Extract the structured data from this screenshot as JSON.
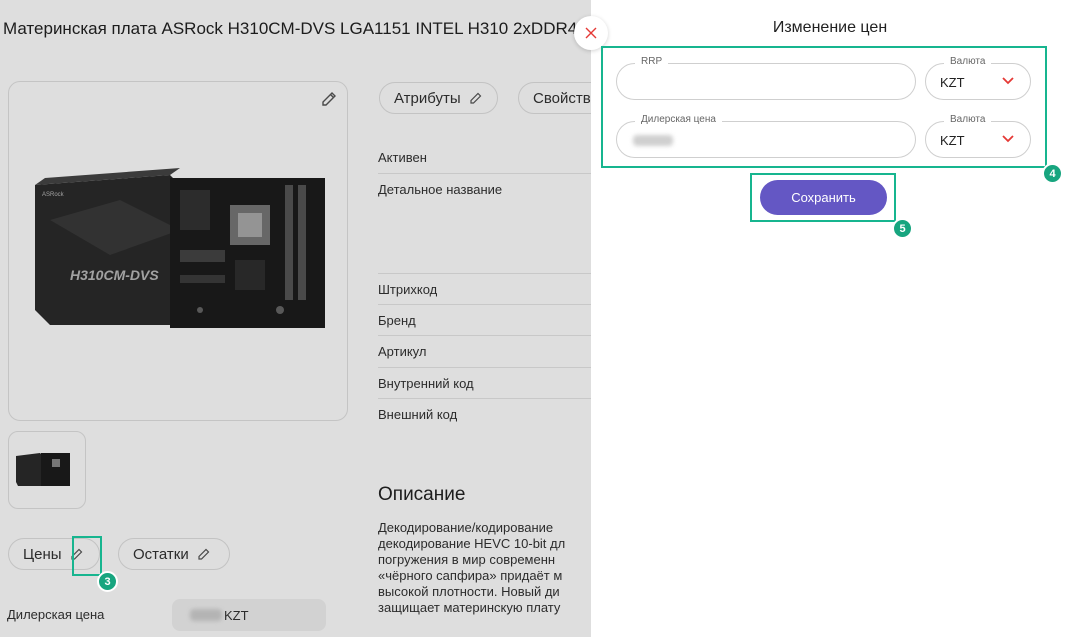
{
  "page": {
    "title": "Материнская плата ASRock H310CM-DVS LGA1151 INTEL H310 2xDDR4",
    "tabs": [
      {
        "label": "Атрибуты"
      },
      {
        "label": "Свойства"
      }
    ],
    "attributes": [
      {
        "label": "Активен"
      },
      {
        "label": "Детальное название"
      },
      {
        "label": "Штрихкод"
      },
      {
        "label": "Бренд"
      },
      {
        "label": "Артикул"
      },
      {
        "label": "Внутренний код"
      },
      {
        "label": "Внешний код"
      }
    ],
    "description": {
      "title": "Описание",
      "lines": [
        "Декодирование/кодирование",
        "декодирование HEVC 10-bit дл",
        "погружения в мир современн",
        "«чёрного сапфира» придаёт м",
        "высокой плотности. Новый ди",
        "защищает материнскую плату"
      ]
    },
    "sections": {
      "prices_label": "Цены",
      "stock_label": "Остатки"
    },
    "dealer_price": {
      "label": "Дилерская цена",
      "currency": "KZT"
    },
    "board_brand": "ASRock",
    "board_model": "H310CM-DVS"
  },
  "drawer": {
    "title": "Изменение цен",
    "rrp": {
      "label": "RRP",
      "value": ""
    },
    "rrp_currency": {
      "label": "Валюта",
      "value": "KZT"
    },
    "dealer": {
      "label": "Дилерская цена",
      "value": ""
    },
    "dealer_currency": {
      "label": "Валюта",
      "value": "KZT"
    },
    "save_label": "Сохранить"
  },
  "annotations": {
    "step3": "3",
    "step4": "4",
    "step5": "5"
  },
  "colors": {
    "accent": "#6457c4",
    "highlight": "#17b58f",
    "close": "#e53935",
    "chevron": "#e53935"
  }
}
